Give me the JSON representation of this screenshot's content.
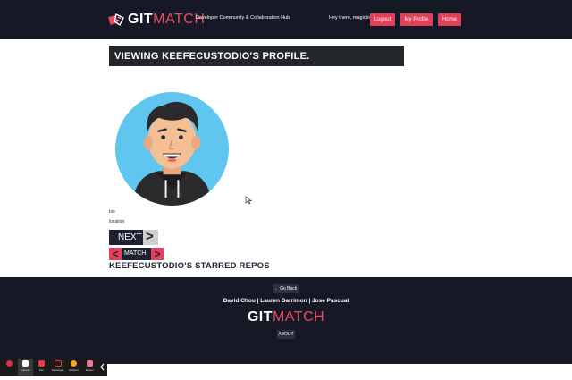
{
  "header": {
    "logo_git": "GIT",
    "logo_match": "MATCH",
    "tagline": "Developer Community & Collaboration Hub",
    "greeting": "Hey there, magiclo!",
    "nav": [
      "Logout",
      "My Profile",
      "Home"
    ],
    "accent": "#e2405a",
    "background": "#161826"
  },
  "profile": {
    "title": "VIEWING KEEFECUSTODIO'S PROFILE.",
    "bio": "bio",
    "location": "location",
    "next_label": "NEXT",
    "next_arrow": ">",
    "match_label": "MATCH",
    "match_left": "<",
    "match_right": ">",
    "starred_heading": "KEEFECUSTODIO'S STARRED REPOS"
  },
  "footer": {
    "go_back": "← Go Back",
    "authors": "David Chou | Lauren Darrimon | Jose Pascual",
    "logo_git": "GIT",
    "logo_match": "MATCH",
    "about": "ABOUT"
  },
  "taskbar": {
    "items": [
      "",
      "Inkness",
      "Pen",
      "Rectangle",
      "Stickers",
      "Eraser"
    ]
  }
}
